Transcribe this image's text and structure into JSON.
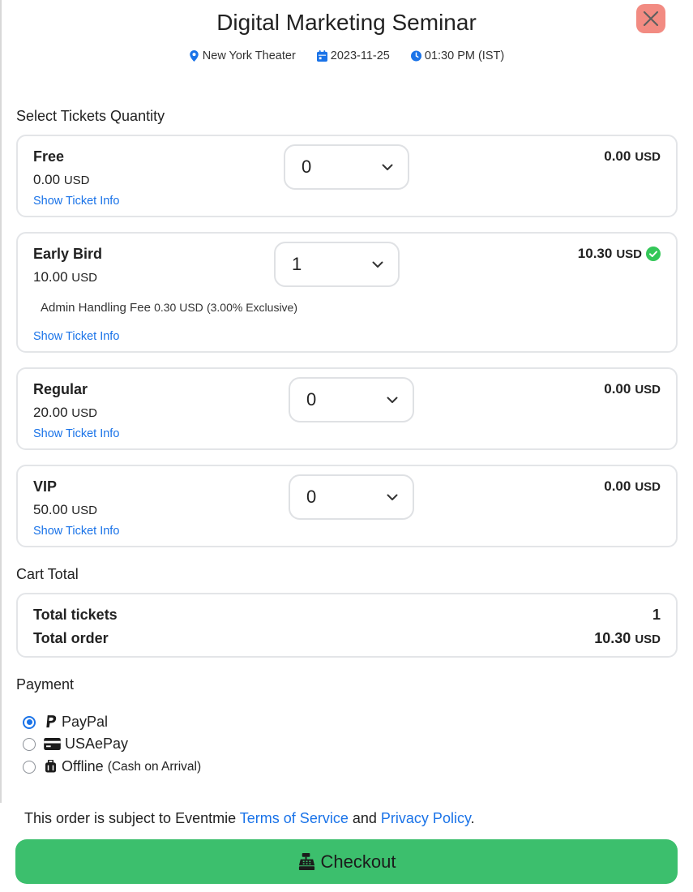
{
  "event": {
    "title": "Digital Marketing Seminar",
    "venue": "New York Theater",
    "date": "2023-11-25",
    "time": "01:30 PM (IST)"
  },
  "labels": {
    "select_tickets": "Select Tickets Quantity",
    "cart_total": "Cart Total",
    "payment": "Payment",
    "show_info": "Show Ticket Info"
  },
  "tickets": [
    {
      "name": "Free",
      "price": "0.00",
      "currency": "USD",
      "quantity": "0",
      "total": "0.00",
      "total_currency": "USD"
    },
    {
      "name": "Early Bird",
      "price": "10.00",
      "currency": "USD",
      "quantity": "1",
      "total": "10.30",
      "total_currency": "USD",
      "fee_label": "Admin Handling Fee",
      "fee_amount": "0.30 USD",
      "fee_note": "(3.00% Exclusive)"
    },
    {
      "name": "Regular",
      "price": "20.00",
      "currency": "USD",
      "quantity": "0",
      "total": "0.00",
      "total_currency": "USD"
    },
    {
      "name": "VIP",
      "price": "50.00",
      "currency": "USD",
      "quantity": "0",
      "total": "0.00",
      "total_currency": "USD"
    }
  ],
  "cart": {
    "total_tickets_label": "Total tickets",
    "total_tickets_value": "1",
    "total_order_label": "Total order",
    "total_order_value": "10.30",
    "total_order_currency": "USD"
  },
  "payment_options": [
    {
      "label": "PayPal",
      "note": "",
      "selected": true,
      "icon": "paypal-icon"
    },
    {
      "label": "USAePay",
      "note": "",
      "selected": false,
      "icon": "credit-card-icon"
    },
    {
      "label": "Offline",
      "note": "(Cash on Arrival)",
      "selected": false,
      "icon": "suitcase-icon"
    }
  ],
  "terms": {
    "prefix": "This order is subject to Eventmie",
    "terms_link": "Terms of Service",
    "and": "and",
    "privacy_link": "Privacy Policy",
    "suffix": "."
  },
  "checkout": {
    "label": "Checkout"
  },
  "colors": {
    "accent": "#1a73e8",
    "checkout_bg": "#3cbf6d",
    "close_bg": "#f28b82",
    "success": "#34c759"
  }
}
